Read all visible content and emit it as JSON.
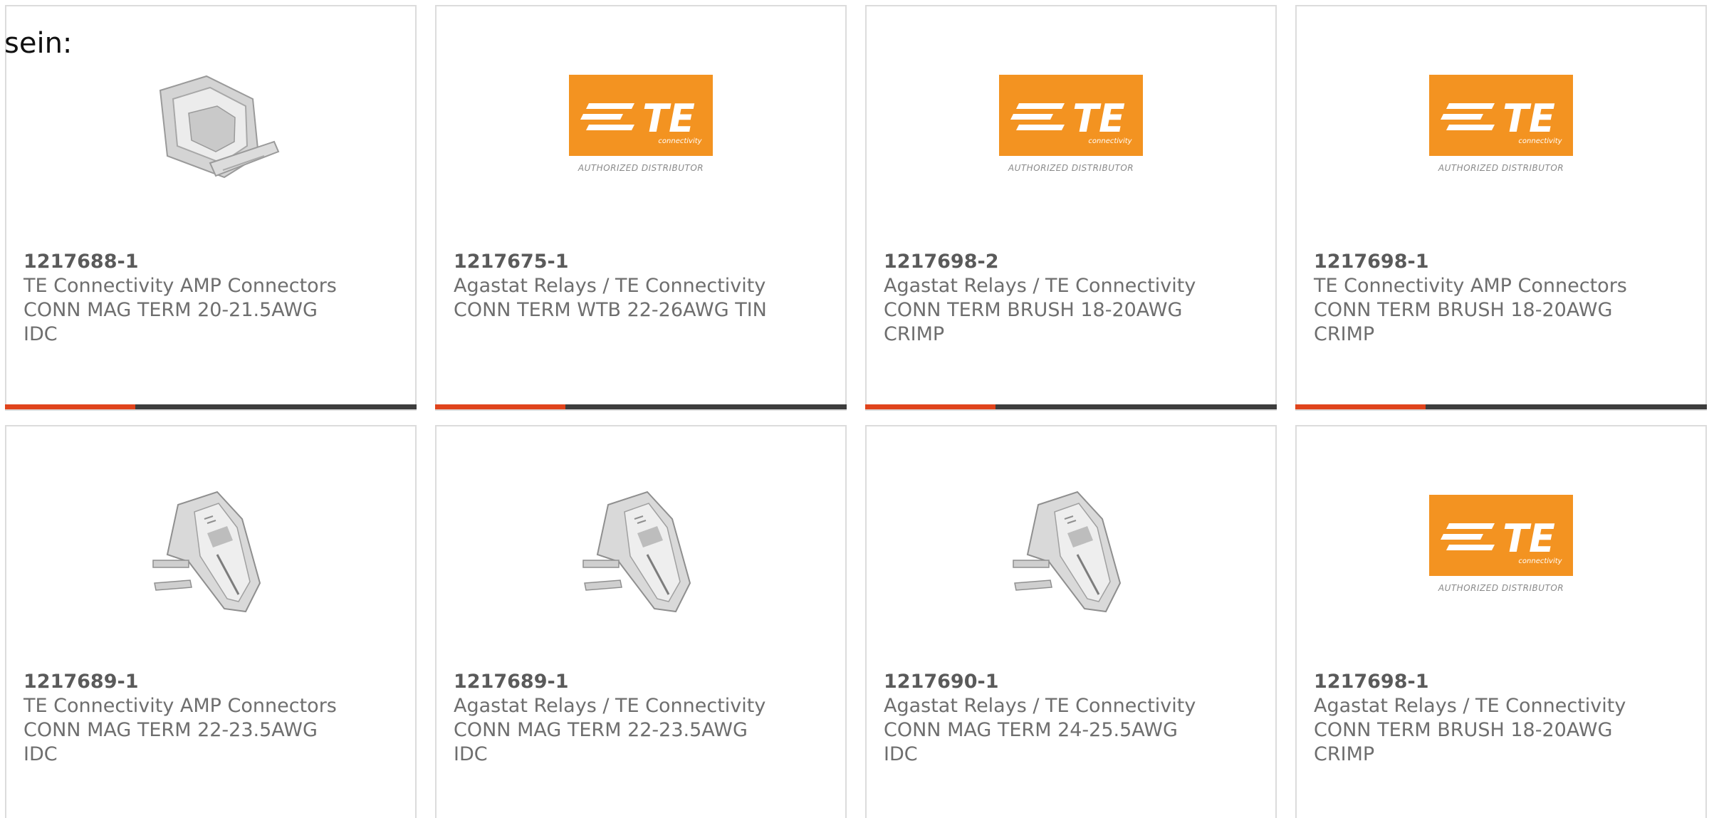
{
  "intro_text": "sein:",
  "colors": {
    "accent": "#e0441c",
    "bar_dark": "#3d3d3d",
    "te_orange": "#f39321"
  },
  "logo": {
    "brand": "TE",
    "sub": "connectivity",
    "tagline": "AUTHORIZED DISTRIBUTOR"
  },
  "products": [
    {
      "part_number": "1217688-1",
      "manufacturer": "TE Connectivity AMP Connectors",
      "desc_line1": "CONN MAG TERM 20-21.5AWG",
      "desc_line2": "IDC",
      "image": "clip-terminal-photo"
    },
    {
      "part_number": "1217675-1",
      "manufacturer": "Agastat Relays / TE Connectivity",
      "desc_line1": "CONN TERM WTB 22-26AWG TIN",
      "desc_line2": "",
      "image": "te-logo"
    },
    {
      "part_number": "1217698-2",
      "manufacturer": "Agastat Relays / TE Connectivity",
      "desc_line1": "CONN TERM BRUSH 18-20AWG",
      "desc_line2": "CRIMP",
      "image": "te-logo"
    },
    {
      "part_number": "1217698-1",
      "manufacturer": "TE Connectivity AMP Connectors",
      "desc_line1": "CONN TERM BRUSH 18-20AWG",
      "desc_line2": "CRIMP",
      "image": "te-logo"
    },
    {
      "part_number": "1217689-1",
      "manufacturer": "TE Connectivity AMP Connectors",
      "desc_line1": "CONN MAG TERM 22-23.5AWG",
      "desc_line2": "IDC",
      "image": "mag-terminal-photo"
    },
    {
      "part_number": "1217689-1",
      "manufacturer": "Agastat Relays / TE Connectivity",
      "desc_line1": "CONN MAG TERM 22-23.5AWG",
      "desc_line2": "IDC",
      "image": "mag-terminal-photo"
    },
    {
      "part_number": "1217690-1",
      "manufacturer": "Agastat Relays / TE Connectivity",
      "desc_line1": "CONN MAG TERM 24-25.5AWG",
      "desc_line2": "IDC",
      "image": "mag-terminal-photo"
    },
    {
      "part_number": "1217698-1",
      "manufacturer": "Agastat Relays / TE Connectivity",
      "desc_line1": "CONN TERM BRUSH 18-20AWG",
      "desc_line2": "CRIMP",
      "image": "te-logo"
    }
  ]
}
